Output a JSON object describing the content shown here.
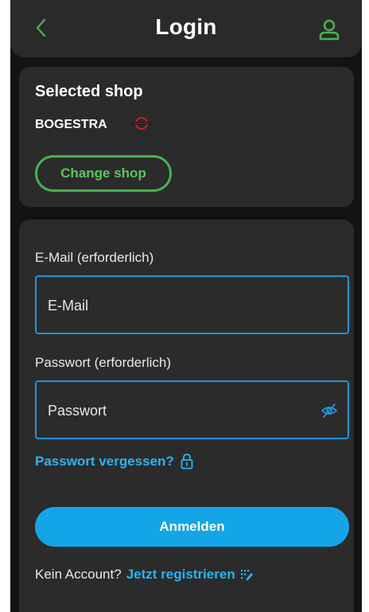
{
  "header": {
    "title": "Login",
    "back_icon": "chevron-left-icon",
    "user_icon": "user-icon",
    "accent_color": "#4caf50"
  },
  "shop": {
    "title": "Selected shop",
    "name": "BOGESTRA",
    "change_label": "Change shop"
  },
  "login": {
    "email_label": "E-Mail (erforderlich)",
    "email_placeholder": "E-Mail",
    "password_label": "Passwort (erforderlich)",
    "password_placeholder": "Passwort",
    "forgot_label": "Passwort vergessen?",
    "submit_label": "Anmelden",
    "no_account_text": "Kein Account?",
    "register_link": "Jetzt registrieren",
    "link_color": "#2bb4f2",
    "button_color": "#14a5e6"
  }
}
